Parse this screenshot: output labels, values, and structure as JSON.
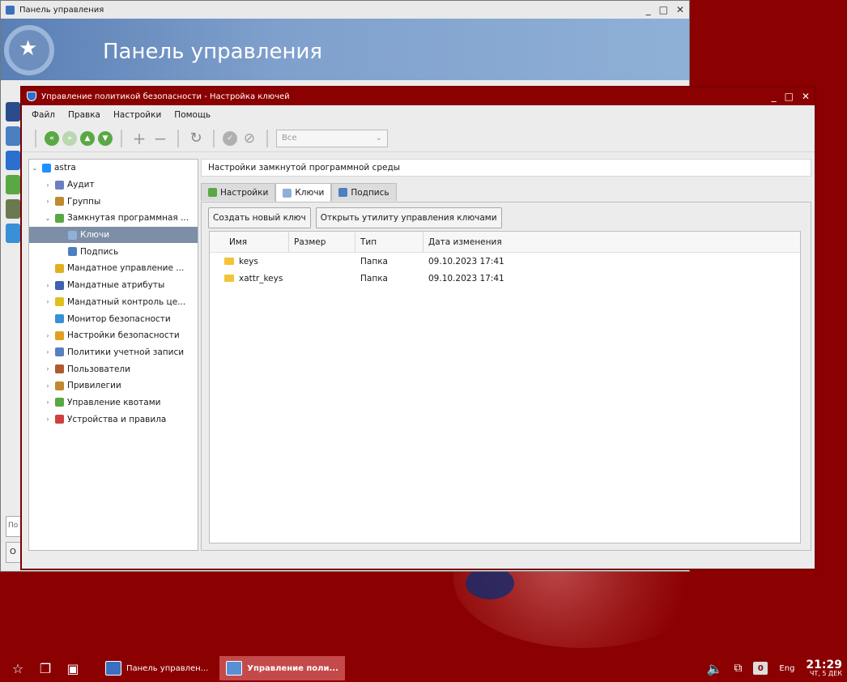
{
  "background_window": {
    "title": "Панель управления",
    "banner_title": "Панель управления",
    "search_placeholder": "По",
    "button_label": "О"
  },
  "main_window": {
    "title": "Управление политикой безопасности - Настройка ключей",
    "menu": [
      "Файл",
      "Правка",
      "Настройки",
      "Помощь"
    ],
    "toolbar": {
      "filter_value": "Все"
    },
    "tree": [
      {
        "label": "astra",
        "level": 0,
        "arrow": "v",
        "icon_color": "#1e90ff"
      },
      {
        "label": "Аудит",
        "level": 1,
        "arrow": ">",
        "icon_color": "#6e7fc0"
      },
      {
        "label": "Группы",
        "level": 1,
        "arrow": ">",
        "icon_color": "#c08a30"
      },
      {
        "label": "Замкнутая программная ...",
        "level": 1,
        "arrow": "v",
        "icon_color": "#5aa845"
      },
      {
        "label": "Ключи",
        "level": 2,
        "arrow": "",
        "icon_color": "#8fb0d6",
        "selected": true
      },
      {
        "label": "Подпись",
        "level": 2,
        "arrow": "",
        "icon_color": "#4a7fc0"
      },
      {
        "label": "Мандатное управление ...",
        "level": 1,
        "arrow": "",
        "icon_color": "#e0b020"
      },
      {
        "label": "Мандатные атрибуты",
        "level": 1,
        "arrow": ">",
        "icon_color": "#4060b0"
      },
      {
        "label": "Мандатный контроль це...",
        "level": 1,
        "arrow": ">",
        "icon_color": "#e0c020"
      },
      {
        "label": "Монитор безопасности",
        "level": 1,
        "arrow": "",
        "icon_color": "#3a8fd6"
      },
      {
        "label": "Настройки безопасности",
        "level": 1,
        "arrow": ">",
        "icon_color": "#e0a020"
      },
      {
        "label": "Политики учетной записи",
        "level": 1,
        "arrow": ">",
        "icon_color": "#5a7fc0"
      },
      {
        "label": "Пользователи",
        "level": 1,
        "arrow": ">",
        "icon_color": "#b05a30"
      },
      {
        "label": "Привилегии",
        "level": 1,
        "arrow": ">",
        "icon_color": "#c08a30"
      },
      {
        "label": "Управление квотами",
        "level": 1,
        "arrow": ">",
        "icon_color": "#5aa845"
      },
      {
        "label": "Устройства и правила",
        "level": 1,
        "arrow": ">",
        "icon_color": "#d04040"
      }
    ],
    "section_header": "Настройки замкнутой программной среды",
    "tabs": [
      {
        "label": "Настройки",
        "active": false
      },
      {
        "label": "Ключи",
        "active": true
      },
      {
        "label": "Подпись",
        "active": false
      }
    ],
    "buttons": {
      "create_key": "Создать новый ключ",
      "open_utility": "Открыть утилиту управления ключами"
    },
    "table": {
      "columns": [
        "Имя",
        "Размер",
        "Тип",
        "Дата изменения"
      ],
      "rows": [
        {
          "name": "keys",
          "size": "",
          "type": "Папка",
          "modified": "09.10.2023 17:41"
        },
        {
          "name": "xattr_keys",
          "size": "",
          "type": "Папка",
          "modified": "09.10.2023 17:41"
        }
      ]
    }
  },
  "taskbar": {
    "tasks": [
      {
        "label": "Панель управлен...",
        "active": false
      },
      {
        "label": "Управление поли...",
        "active": true
      }
    ],
    "workspace_number": "0",
    "keyboard_layout": "Eng",
    "time": "21:29",
    "date": "ЧТ, 5 ДЕК"
  },
  "colors": {
    "desktop": "#8b0000",
    "main_titlebar": "#8b0000",
    "selection": "#7d8fa6",
    "toolbar_green": "#5aa845"
  }
}
